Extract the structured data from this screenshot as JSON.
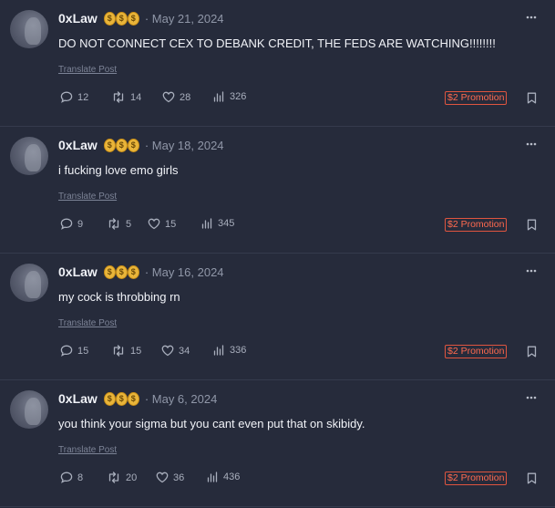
{
  "posts": [
    {
      "author": "0xLaw",
      "badge_symbol": "$",
      "date": "· May 21, 2024",
      "text": "DO NOT CONNECT CEX TO DEBANK CREDIT, THE FEDS ARE WATCHING!!!!!!!!",
      "translate_label": "Translate Post",
      "comments": "12",
      "reposts": "14",
      "likes": "28",
      "views": "326",
      "promotion_label": "$2 Promotion"
    },
    {
      "author": "0xLaw",
      "badge_symbol": "$",
      "date": "· May 18, 2024",
      "text": "i fucking love emo girls",
      "translate_label": "Translate Post",
      "comments": "9",
      "reposts": "5",
      "likes": "15",
      "views": "345",
      "promotion_label": "$2 Promotion"
    },
    {
      "author": "0xLaw",
      "badge_symbol": "$",
      "date": "· May 16, 2024",
      "text": "my cock is throbbing rn",
      "translate_label": "Translate Post",
      "comments": "15",
      "reposts": "15",
      "likes": "34",
      "views": "336",
      "promotion_label": "$2 Promotion"
    },
    {
      "author": "0xLaw",
      "badge_symbol": "$",
      "date": "· May 6, 2024",
      "text": "you think your sigma but you cant even put that on skibidy.",
      "translate_label": "Translate Post",
      "comments": "8",
      "reposts": "20",
      "likes": "36",
      "views": "436",
      "promotion_label": "$2 Promotion"
    }
  ],
  "icons": {
    "more": "more-horizontal-icon",
    "comment": "comment-icon",
    "repost": "repost-icon",
    "like": "heart-icon",
    "views": "views-bar-icon",
    "bookmark": "bookmark-icon"
  },
  "colors": {
    "background": "#262b3b",
    "promo": "#ff6a4f",
    "coin": "#e9b53a"
  }
}
